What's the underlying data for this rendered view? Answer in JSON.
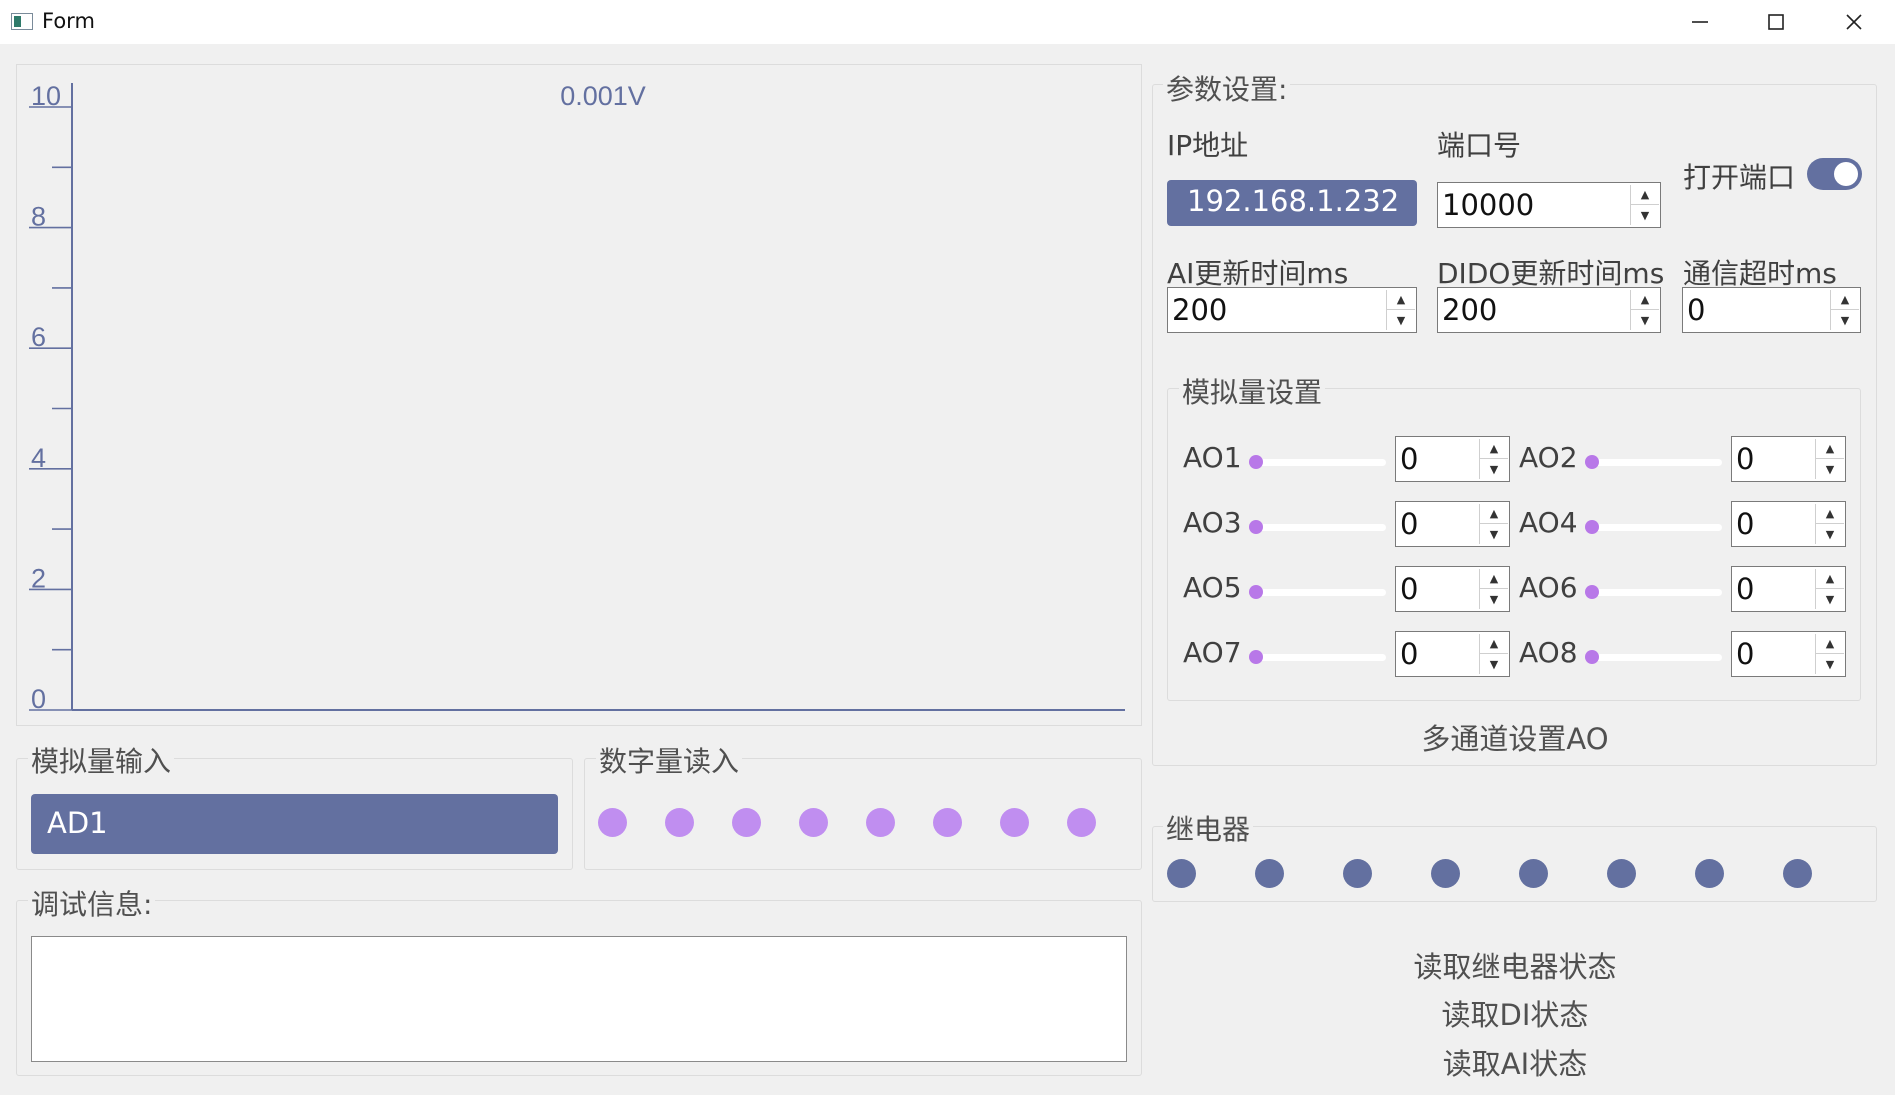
{
  "window": {
    "title": "Form"
  },
  "chart_data": {
    "type": "line",
    "title": "0.001V",
    "xlabel": "",
    "ylabel": "",
    "ylim": [
      0,
      10
    ],
    "yticks_major": [
      "0",
      "2",
      "4",
      "6",
      "8",
      "10"
    ],
    "grid": false,
    "series": [
      {
        "values": [
          0,
          0,
          0,
          0,
          0,
          0,
          0,
          0,
          0,
          0,
          0,
          0,
          0,
          0,
          0,
          0,
          0,
          0,
          0,
          0
        ]
      }
    ],
    "colors": {
      "axis": "#6370a0",
      "line": "#6370a0",
      "title": "#6370a0"
    }
  },
  "params": {
    "group_title": "参数设置:",
    "ip_label": "IP地址",
    "ip_value": "192.168.1.232",
    "port_label": "端口号",
    "port_value": "10000",
    "open_port_label": "打开端口",
    "open_port_on": true,
    "ai_update_label": "AI更新时间ms",
    "ai_update_value": "200",
    "dido_update_label": "DIDO更新时间ms",
    "dido_update_value": "200",
    "timeout_label": "通信超时ms",
    "timeout_value": "0"
  },
  "analog_settings": {
    "title": "模拟量设置",
    "channels": [
      {
        "label": "AO1",
        "value": "0"
      },
      {
        "label": "AO2",
        "value": "0"
      },
      {
        "label": "AO3",
        "value": "0"
      },
      {
        "label": "AO4",
        "value": "0"
      },
      {
        "label": "AO5",
        "value": "0"
      },
      {
        "label": "AO6",
        "value": "0"
      },
      {
        "label": "AO7",
        "value": "0"
      },
      {
        "label": "AO8",
        "value": "0"
      }
    ],
    "multi_button": "多通道设置AO"
  },
  "analog_input": {
    "title": "模拟量输入",
    "selected": "AD1"
  },
  "digital_input": {
    "title": "数字量读入",
    "count": 8
  },
  "relay": {
    "title": "继电器",
    "count": 8
  },
  "debug": {
    "title": "调试信息:",
    "text": ""
  },
  "buttons": {
    "read_relay": "读取继电器状态",
    "read_di": "读取DI状态",
    "read_ai": "读取AI状态"
  },
  "colors": {
    "accent": "#6370a0",
    "di_dot": "#c08ef0",
    "slider_knob": "#b878e8"
  }
}
